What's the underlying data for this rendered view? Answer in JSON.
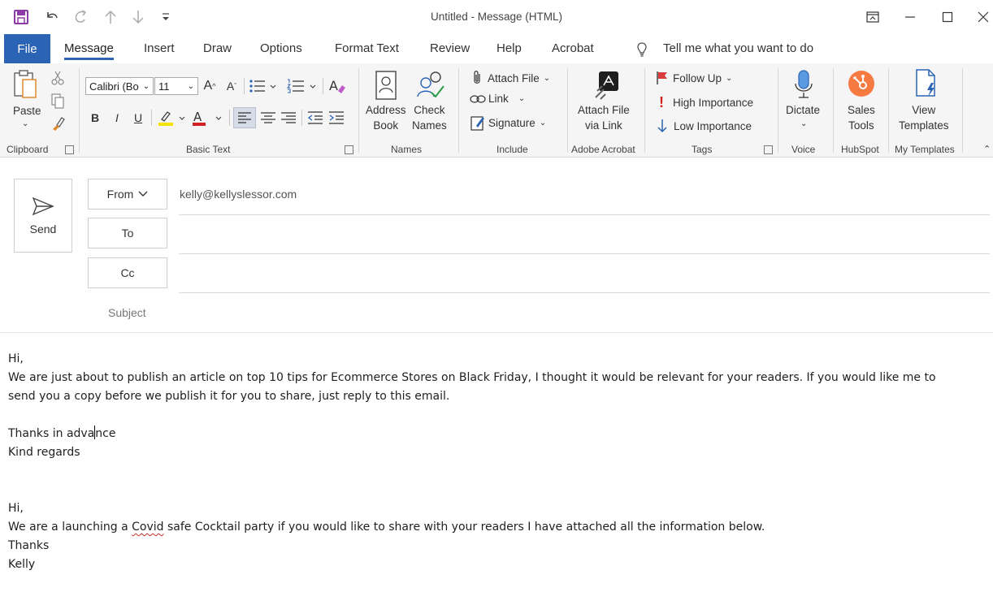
{
  "window": {
    "title": "Untitled  -  Message (HTML)"
  },
  "tabs": {
    "file": "File",
    "message": "Message",
    "insert": "Insert",
    "draw": "Draw",
    "options": "Options",
    "format_text": "Format Text",
    "review": "Review",
    "help": "Help",
    "acrobat": "Acrobat",
    "tell_me": "Tell me what you want to do"
  },
  "ribbon": {
    "clipboard": {
      "paste": "Paste",
      "group": "Clipboard"
    },
    "basic_text": {
      "font": "Calibri (Bo",
      "size": "11",
      "bold": "B",
      "italic": "I",
      "underline": "U",
      "group": "Basic Text"
    },
    "names": {
      "address_book_1": "Address",
      "address_book_2": "Book",
      "check_names_1": "Check",
      "check_names_2": "Names",
      "group": "Names"
    },
    "include": {
      "attach_file": "Attach File",
      "link": "Link",
      "signature": "Signature",
      "group": "Include"
    },
    "adobe": {
      "line1": "Attach File",
      "line2": "via Link",
      "group": "Adobe Acrobat"
    },
    "tags": {
      "follow_up": "Follow Up",
      "high": "High Importance",
      "low": "Low Importance",
      "group": "Tags"
    },
    "voice": {
      "dictate": "Dictate",
      "group": "Voice"
    },
    "hubspot": {
      "line1": "Sales",
      "line2": "Tools",
      "group": "HubSpot"
    },
    "templates": {
      "line1": "View",
      "line2": "Templates",
      "group": "My Templates"
    }
  },
  "compose": {
    "send": "Send",
    "from_label": "From",
    "from_address": "kelly@kellyslessor.com",
    "to_label": "To",
    "cc_label": "Cc",
    "subject_label": "Subject"
  },
  "body": {
    "p1_greeting": "Hi,",
    "p1_line1": "We are just about to publish an article on top 10 tips for Ecommerce Stores on Black Friday, I thought it would be relevant for your readers.  If you would like me to",
    "p1_line2": "send you a copy before we publish it for you to share, just reply to this email.",
    "p1_thanks_a": "Thanks in adva",
    "p1_thanks_b": "nce",
    "p1_regards": "Kind regards",
    "p2_greeting": "Hi,",
    "p2_line1_a": "We are a launching a ",
    "p2_line1_b": "Covid",
    "p2_line1_c": " safe Cocktail party if you would like to share with your readers I have attached all the information below.",
    "p2_thanks": "Thanks",
    "p2_name": "Kelly"
  },
  "colors": {
    "accent": "#2b63b5",
    "ribbon_bg": "#f5f5f5",
    "save_purple": "#8e3aa8",
    "hubspot_orange": "#f57b43",
    "flag_red": "#d83b3b"
  }
}
